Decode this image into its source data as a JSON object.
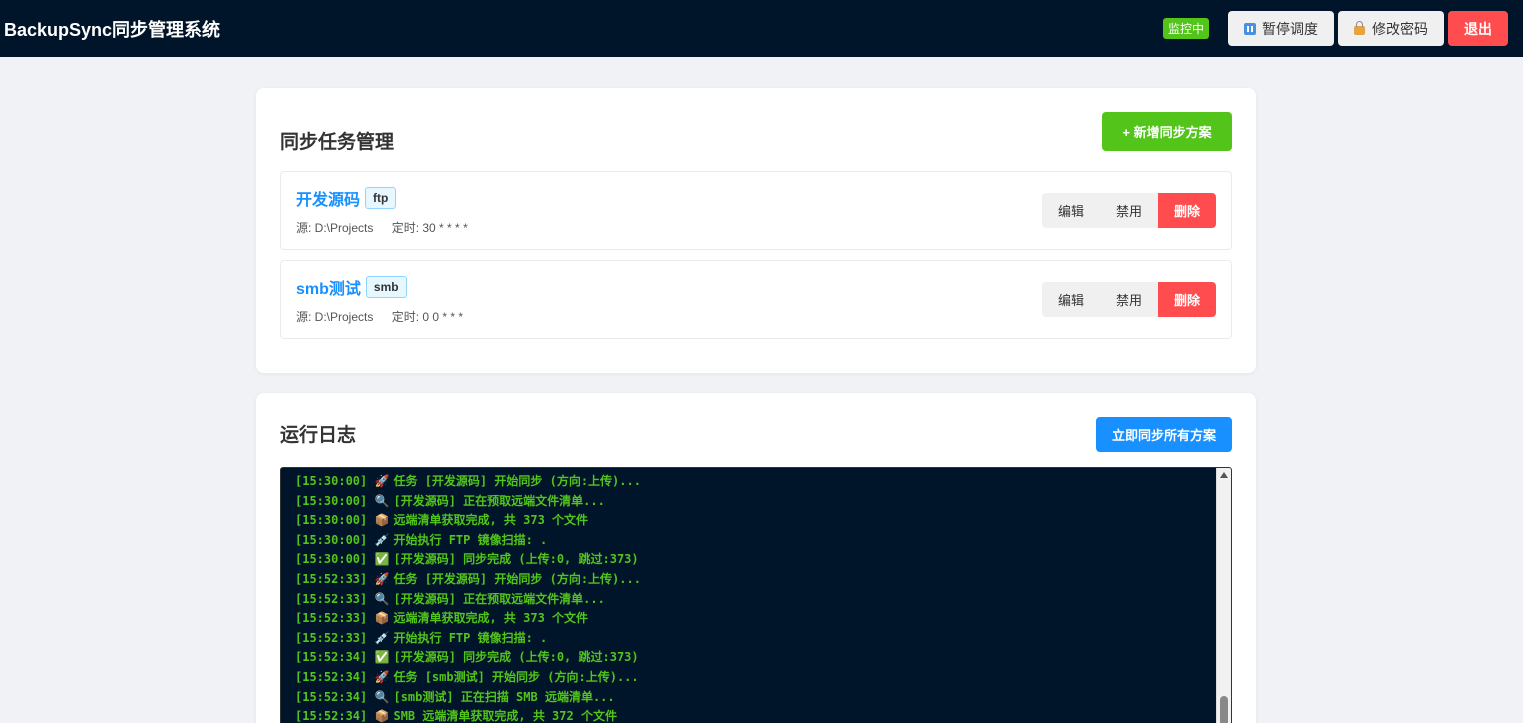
{
  "header": {
    "title": "BackupSync同步管理系统",
    "status_badge": "监控中",
    "pause_label": "暂停调度",
    "change_password_label": "修改密码",
    "logout_label": "退出"
  },
  "tasks_section": {
    "title": "同步任务管理",
    "add_label": "+ 新增同步方案",
    "tasks": [
      {
        "name": "开发源码",
        "protocol": "ftp",
        "source": "源: D:\\Projects",
        "schedule": "定时: 30 * * * *",
        "edit_label": "编辑",
        "disable_label": "禁用",
        "delete_label": "删除"
      },
      {
        "name": "smb测试",
        "protocol": "smb",
        "source": "源: D:\\Projects",
        "schedule": "定时: 0 0 * * *",
        "edit_label": "编辑",
        "disable_label": "禁用",
        "delete_label": "删除"
      }
    ]
  },
  "log_section": {
    "title": "运行日志",
    "sync_all_label": "立即同步所有方案",
    "lines": [
      {
        "time": "[15:30:00]",
        "icon": "rocket-icon",
        "text": "任务 [开发源码] 开始同步 (方向:上传)..."
      },
      {
        "time": "[15:30:00]",
        "icon": "magnifier-icon",
        "text": "[开发源码] 正在预取远端文件清单..."
      },
      {
        "time": "[15:30:00]",
        "icon": "package-icon",
        "text": "远端清单获取完成, 共 373 个文件"
      },
      {
        "time": "[15:30:00]",
        "icon": "syringe-icon",
        "text": "开始执行 FTP 镜像扫描: ."
      },
      {
        "time": "[15:30:00]",
        "icon": "check-icon",
        "text": "[开发源码] 同步完成 (上传:0, 跳过:373)"
      },
      {
        "time": "[15:52:33]",
        "icon": "rocket-icon",
        "text": "任务 [开发源码] 开始同步 (方向:上传)..."
      },
      {
        "time": "[15:52:33]",
        "icon": "magnifier-icon",
        "text": "[开发源码] 正在预取远端文件清单..."
      },
      {
        "time": "[15:52:33]",
        "icon": "package-icon",
        "text": "远端清单获取完成, 共 373 个文件"
      },
      {
        "time": "[15:52:33]",
        "icon": "syringe-icon",
        "text": "开始执行 FTP 镜像扫描: ."
      },
      {
        "time": "[15:52:34]",
        "icon": "check-icon",
        "text": "[开发源码] 同步完成 (上传:0, 跳过:373)"
      },
      {
        "time": "[15:52:34]",
        "icon": "rocket-icon",
        "text": "任务 [smb测试] 开始同步 (方向:上传)..."
      },
      {
        "time": "[15:52:34]",
        "icon": "magnifier-icon",
        "text": "[smb测试] 正在扫描 SMB 远端清单..."
      },
      {
        "time": "[15:52:34]",
        "icon": "package-icon",
        "text": "SMB 远端清单获取完成, 共 372 个文件"
      }
    ]
  },
  "colors": {
    "header_bg": "#001529",
    "success": "#52c41a",
    "primary": "#1890ff",
    "danger": "#ff4d4f",
    "log_text": "#52c41a"
  }
}
